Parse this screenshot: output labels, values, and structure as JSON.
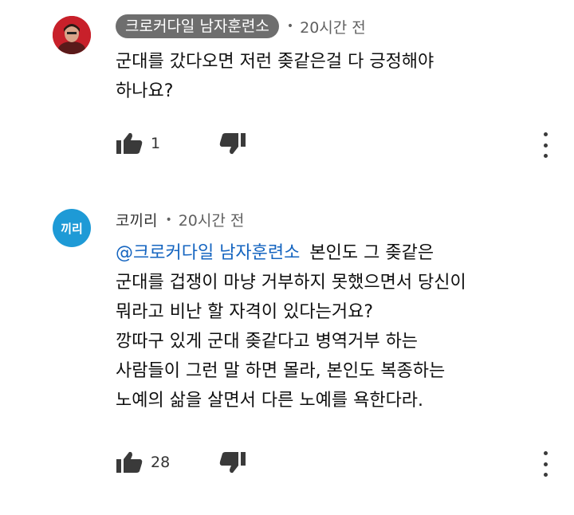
{
  "comments": [
    {
      "author": "크로커다일 남자훈련소",
      "time": "20시간 전",
      "lines": [
        "군대를 갔다오면 저런 좆같은걸 다 긍정해야",
        "하나요?"
      ],
      "likes": "1",
      "avatar_color": "#c8202a"
    },
    {
      "author": "코끼리",
      "avatar_text": "끼리",
      "time": "20시간 전",
      "mention": "@크로커다일 남자훈련소",
      "first_line_rest": "본인도 그 좆같은",
      "lines": [
        "군대를 겁쟁이 마냥 거부하지 못했으면서 당신이",
        "뭐라고 비난 할 자격이 있다는거요?",
        "깡따구 있게 군대 좆같다고 병역거부 하는",
        "사람들이 그런 말 하면 몰라, 본인도 복종하는",
        "노예의 삶을 살면서 다른 노예를 욕한다라."
      ],
      "likes": "28",
      "avatar_color": "#1e9ad6",
      "mention_color": "#1565c0"
    }
  ],
  "separator": "•"
}
